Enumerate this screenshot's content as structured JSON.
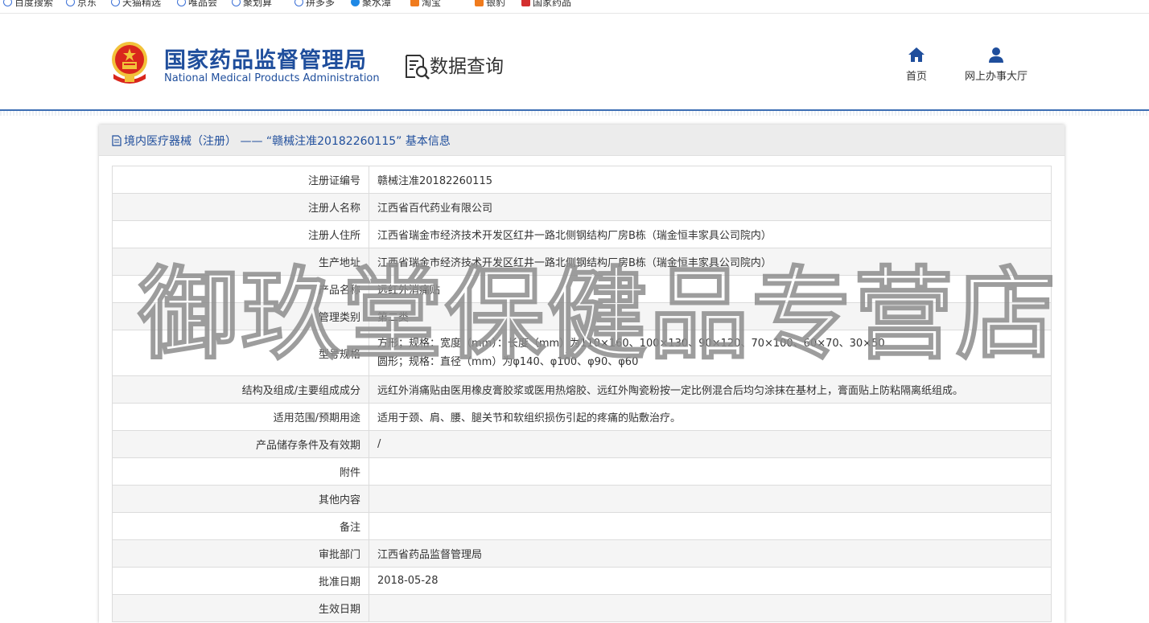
{
  "bookmarks": [
    {
      "label": "百度搜索",
      "icon": "paw-icon"
    },
    {
      "label": "京东",
      "icon": "globe-icon"
    },
    {
      "label": "天猫精选",
      "icon": "globe-icon"
    },
    {
      "label": "唯品会",
      "icon": "globe-icon"
    },
    {
      "label": "聚划算",
      "icon": "globe-icon"
    },
    {
      "label": "拼多多",
      "icon": "globe-icon"
    },
    {
      "label": "聚水潭",
      "icon": "globe-icon"
    },
    {
      "label": "淘宝",
      "icon": "globe-icon"
    },
    {
      "label": "银豹",
      "icon": "globe-icon"
    },
    {
      "label": "国家药品",
      "icon": "globe-icon"
    }
  ],
  "header": {
    "site_name_cn": "国家药品监督管理局",
    "site_name_en": "National Medical Products Administration",
    "query_label": "数据查询",
    "nav": [
      {
        "label": "首页",
        "icon": "home-icon"
      },
      {
        "label": "网上办事大厅",
        "icon": "user-icon"
      }
    ]
  },
  "panel": {
    "title": "境内医疗器械（注册） —— “赣械注准20182260115” 基本信息"
  },
  "table": {
    "rows": [
      {
        "label": "注册证编号",
        "value": "赣械注准20182260115"
      },
      {
        "label": "注册人名称",
        "value": "江西省百代药业有限公司"
      },
      {
        "label": "注册人住所",
        "value": "江西省瑞金市经济技术开发区红井一路北侧钢结构厂房B栋（瑞金恒丰家具公司院内）"
      },
      {
        "label": "生产地址",
        "value": "江西省瑞金市经济技术开发区红井一路北侧钢结构厂房B栋（瑞金恒丰家具公司院内）"
      },
      {
        "label": "产品名称",
        "value": "远红外消痛贴"
      },
      {
        "label": "管理类别",
        "value": "第二类"
      },
      {
        "label": "型号规格",
        "value_lines": [
          "方形；规格：宽度（mm）：长度（mm）为110×160、100×130、90×120、70×100、60×70、30×50",
          "圆形；规格：直径（mm）为φ140、φ100、φ90、φ60"
        ]
      },
      {
        "label": "结构及组成/主要组成成分",
        "value": "远红外消痛贴由医用橡皮膏胶浆或医用热熔胶、远红外陶瓷粉按一定比例混合后均匀涂抹在基材上，膏面贴上防粘隔离纸组成。"
      },
      {
        "label": "适用范围/预期用途",
        "value": "适用于颈、肩、腰、腿关节和软组织损伤引起的疼痛的贴敷治疗。"
      },
      {
        "label": "产品储存条件及有效期",
        "value": "/"
      },
      {
        "label": "附件",
        "value": ""
      },
      {
        "label": "其他内容",
        "value": ""
      },
      {
        "label": "备注",
        "value": ""
      },
      {
        "label": "审批部门",
        "value": "江西省药品监督管理局"
      },
      {
        "label": "批准日期",
        "value": "2018-05-28"
      },
      {
        "label": "生效日期",
        "value": ""
      }
    ]
  },
  "watermark": "御玖堂保健品专营店",
  "colors": {
    "brand_blue": "#1f4e9c",
    "header_line": "#3c6eb4",
    "emblem_red": "#d9261c",
    "emblem_gold": "#f2c23a"
  }
}
